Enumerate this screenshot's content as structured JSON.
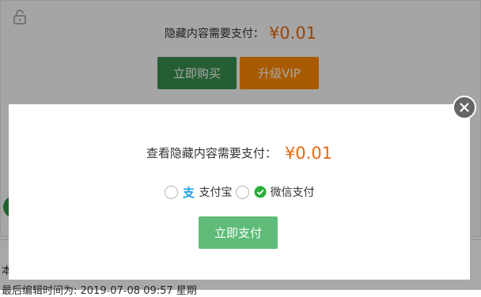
{
  "background": {
    "price_label": "隐藏内容需要支付：",
    "price_value": "¥0.01",
    "buy_button": "立即购买",
    "vip_button": "升级VIP",
    "footer_char": "本",
    "edit_time": "最后编辑时间为: 2019-07-08 09:57 星期"
  },
  "modal": {
    "price_label": "查看隐藏内容需要支付：",
    "price_value": "¥0.01",
    "payment_options": [
      {
        "label": "支付宝",
        "icon": "alipay-icon"
      },
      {
        "label": "微信支付",
        "icon": "wechat-pay-icon"
      }
    ],
    "pay_button": "立即支付"
  },
  "colors": {
    "price": "#e86a0b",
    "buy_button": "#3b8f4e",
    "vip_button": "#ff8a00",
    "pay_button": "#5fbb78",
    "alipay": "#1a9fe0",
    "wechat": "#2aae3a"
  }
}
